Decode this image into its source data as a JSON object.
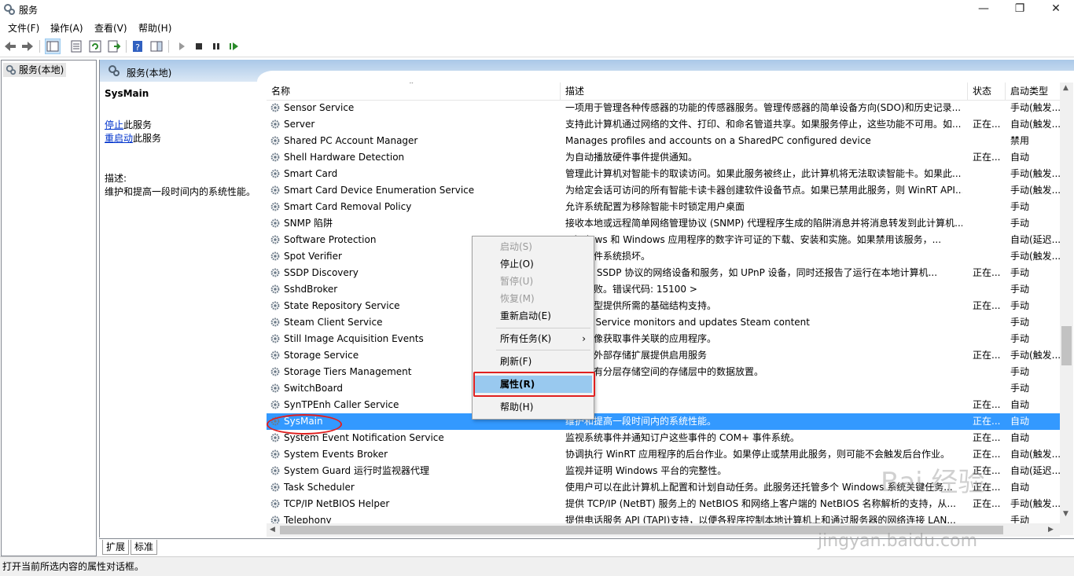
{
  "window": {
    "title": "服务"
  },
  "menu": [
    "文件(F)",
    "操作(A)",
    "查看(V)",
    "帮助(H)"
  ],
  "tree": {
    "root": "服务(本地)"
  },
  "banner": {
    "title": "服务(本地)"
  },
  "extended": {
    "service_name": "SysMain",
    "stop_link": "停止",
    "stop_suffix": "此服务",
    "restart_link": "重启动",
    "restart_suffix": "此服务",
    "desc_label": "描述:",
    "desc_text": "维护和提高一段时间内的系统性能。"
  },
  "columns": [
    "名称",
    "描述",
    "状态",
    "启动类型"
  ],
  "rows": [
    {
      "name": "Sensor Service",
      "desc": "一项用于管理各种传感器的功能的传感器服务。管理传感器的简单设备方向(SDO)和历史记录...",
      "state": "",
      "type": "手动(触发..."
    },
    {
      "name": "Server",
      "desc": "支持此计算机通过网络的文件、打印、和命名管道共享。如果服务停止，这些功能不可用。如...",
      "state": "正在...",
      "type": "自动(触发..."
    },
    {
      "name": "Shared PC Account Manager",
      "desc": "Manages profiles and accounts on a SharedPC configured device",
      "state": "",
      "type": "禁用"
    },
    {
      "name": "Shell Hardware Detection",
      "desc": "为自动播放硬件事件提供通知。",
      "state": "正在...",
      "type": "自动"
    },
    {
      "name": "Smart Card",
      "desc": "管理此计算机对智能卡的取读访问。如果此服务被终止，此计算机将无法取读智能卡。如果此...",
      "state": "",
      "type": "手动(触发..."
    },
    {
      "name": "Smart Card Device Enumeration Service",
      "desc": "为给定会话可访问的所有智能卡读卡器创建软件设备节点。如果已禁用此服务，则 WinRT API...",
      "state": "",
      "type": "手动(触发..."
    },
    {
      "name": "Smart Card Removal Policy",
      "desc": "允许系统配置为移除智能卡时锁定用户桌面",
      "state": "",
      "type": "手动"
    },
    {
      "name": "SNMP 陷阱",
      "desc": "接收本地或远程简单网络管理协议 (SNMP) 代理程序生成的陷阱消息并将消息转发到此计算机...",
      "state": "",
      "type": "手动"
    },
    {
      "name": "Software Protection",
      "desc": "Windows 和 Windows 应用程序的数字许可证的下载、安装和实施。如果禁用该服务，...",
      "state": "",
      "type": "自动(延迟..."
    },
    {
      "name": "Spot Verifier",
      "desc": "在的文件系统损坏。",
      "state": "",
      "type": "手动(触发..."
    },
    {
      "name": "SSDP Discovery",
      "desc": "了使用 SSDP 协议的网络设备和服务，如 UPnP 设备，同时还报告了运行在本地计算机...",
      "state": "正在...",
      "type": "手动"
    },
    {
      "name": "SshdBroker",
      "desc": "描述失败。错误代码: 15100 >",
      "state": "",
      "type": "手动"
    },
    {
      "name": "State Repository Service",
      "desc": "程序模型提供所需的基础结构支持。",
      "state": "正在...",
      "type": "手动"
    },
    {
      "name": "Steam Client Service",
      "desc": "Client Service monitors and updates Steam content",
      "state": "",
      "type": "手动"
    },
    {
      "name": "Still Image Acquisition Events",
      "desc": "静态映像获取事件关联的应用程序。",
      "state": "",
      "type": "手动"
    },
    {
      "name": "Storage Service",
      "desc": "设置和外部存储扩展提供启用服务",
      "state": "正在...",
      "type": "手动(触发..."
    },
    {
      "name": "Storage Tiers Management",
      "desc": "统中所有分层存储空间的存储层中的数据放置。",
      "state": "",
      "type": "手动"
    },
    {
      "name": "SwitchBoard",
      "desc": "",
      "state": "",
      "type": "手动"
    },
    {
      "name": "SynTPEnh Caller Service",
      "desc": "",
      "state": "正在...",
      "type": "自动"
    },
    {
      "name": "SysMain",
      "desc": "维护和提高一段时间内的系统性能。",
      "state": "正在...",
      "type": "自动",
      "selected": true
    },
    {
      "name": "System Event Notification Service",
      "desc": "监视系统事件并通知订户这些事件的 COM+ 事件系统。",
      "state": "正在...",
      "type": "自动"
    },
    {
      "name": "System Events Broker",
      "desc": "协调执行 WinRT 应用程序的后台作业。如果停止或禁用此服务，则可能不会触发后台作业。",
      "state": "正在...",
      "type": "自动(触发..."
    },
    {
      "name": "System Guard 运行时监视器代理",
      "desc": "监视并证明 Windows 平台的完整性。",
      "state": "正在...",
      "type": "自动(延迟..."
    },
    {
      "name": "Task Scheduler",
      "desc": "使用户可以在此计算机上配置和计划自动任务。此服务还托管多个 Windows 系统关键任务...",
      "state": "正在...",
      "type": "自动"
    },
    {
      "name": "TCP/IP NetBIOS Helper",
      "desc": "提供 TCP/IP (NetBT) 服务上的 NetBIOS 和网络上客户端的 NetBIOS 名称解析的支持，从...",
      "state": "正在...",
      "type": "手动(触发..."
    },
    {
      "name": "Telephony",
      "desc": "提供电话服务 API (TAPI)支持，以便各程序控制本地计算机上和通过服务器的网络连接 LAN...",
      "state": "",
      "type": "手动"
    }
  ],
  "context_menu": {
    "start": "启动(S)",
    "stop": "停止(O)",
    "pause": "暂停(U)",
    "resume": "恢复(M)",
    "restart": "重新启动(E)",
    "all_tasks": "所有任务(K)",
    "refresh": "刷新(F)",
    "properties": "属性(R)",
    "help": "帮助(H)"
  },
  "tabs": [
    "扩展",
    "标准"
  ],
  "status": "打开当前所选内容的属性对话框。",
  "watermark": {
    "logo": "Bai 经验",
    "url": "jingyan.baidu.com"
  },
  "colors": {
    "selection": "#3399ff",
    "menu_highlight": "#99c9ef",
    "annotation": "#e02020",
    "link": "#0033cc"
  }
}
